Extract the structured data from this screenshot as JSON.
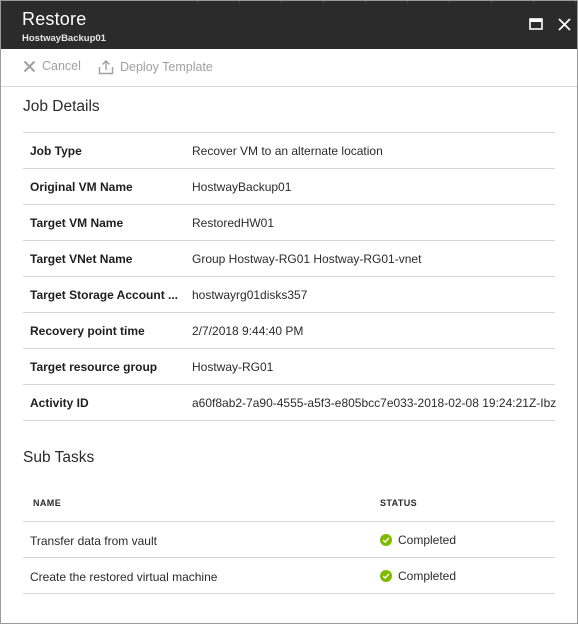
{
  "header": {
    "title": "Restore",
    "subtitle": "HostwayBackup01"
  },
  "toolbar": {
    "cancel_label": "Cancel",
    "deploy_label": "Deploy Template"
  },
  "job_details": {
    "title": "Job Details",
    "rows": [
      {
        "label": "Job Type",
        "value": "Recover VM to an alternate location"
      },
      {
        "label": "Original VM Name",
        "value": "HostwayBackup01"
      },
      {
        "label": "Target VM Name",
        "value": "RestoredHW01"
      },
      {
        "label": "Target VNet Name",
        "value": "Group Hostway-RG01 Hostway-RG01-vnet"
      },
      {
        "label": "Target Storage Account ...",
        "value": "hostwayrg01disks357"
      },
      {
        "label": "Recovery point time",
        "value": "2/7/2018 9:44:40 PM"
      },
      {
        "label": "Target resource group",
        "value": "Hostway-RG01"
      },
      {
        "label": "Activity ID",
        "value": "a60f8ab2-7a90-4555-a5f3-e805bcc7e033-2018-02-08 19:24:21Z-Ibz"
      }
    ]
  },
  "sub_tasks": {
    "title": "Sub Tasks",
    "columns": {
      "name": "NAME",
      "status": "STATUS"
    },
    "rows": [
      {
        "name": "Transfer data from vault",
        "status": "Completed"
      },
      {
        "name": "Create the restored virtual machine",
        "status": "Completed"
      }
    ]
  },
  "colors": {
    "header_bg": "#2b2b2b",
    "success": "#7fba00",
    "disabled_text": "#a0a0a0"
  }
}
